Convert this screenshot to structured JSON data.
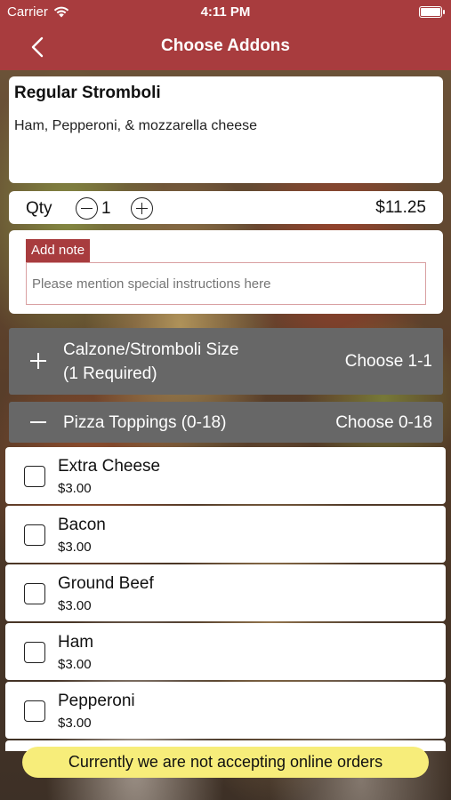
{
  "status_bar": {
    "carrier": "Carrier",
    "time": "4:11 PM"
  },
  "nav": {
    "title": "Choose Addons"
  },
  "item": {
    "name": "Regular Stromboli",
    "description": "Ham, Pepperoni, & mozzarella cheese"
  },
  "quantity": {
    "label": "Qty",
    "value": "1",
    "price": "$11.25"
  },
  "note": {
    "tab_label": "Add note",
    "placeholder": "Please mention special instructions here"
  },
  "groups": [
    {
      "title_line1": "Calzone/Stromboli Size",
      "title_line2": "(1 Required)",
      "choose": "Choose 1-1",
      "expanded": false
    },
    {
      "title_line1": "Pizza Toppings (0-18)",
      "choose": "Choose 0-18",
      "expanded": true
    }
  ],
  "options": [
    {
      "name": "Extra Cheese",
      "price": "$3.00"
    },
    {
      "name": "Bacon",
      "price": "$3.00"
    },
    {
      "name": "Ground Beef",
      "price": "$3.00"
    },
    {
      "name": "Ham",
      "price": "$3.00"
    },
    {
      "name": "Pepperoni",
      "price": "$3.00"
    }
  ],
  "banner": {
    "text": "Currently we are not accepting online orders"
  },
  "colors": {
    "accent": "#a83c3e",
    "group_header": "#676767",
    "banner": "#f7ed7a"
  }
}
